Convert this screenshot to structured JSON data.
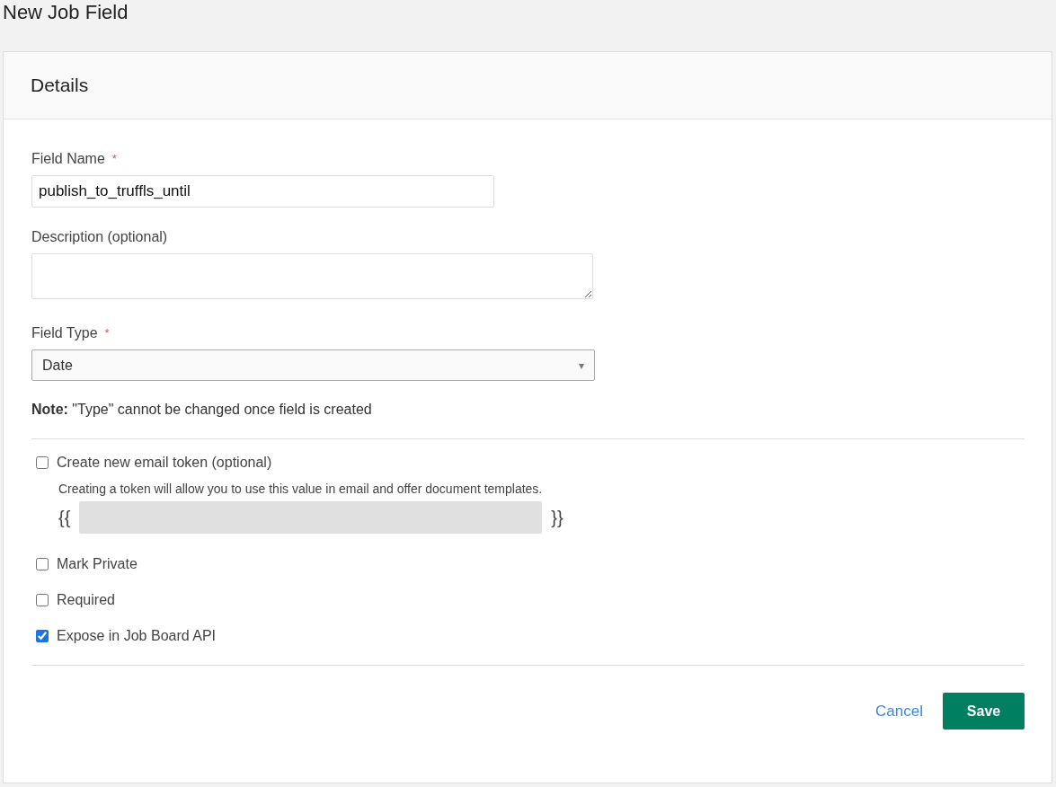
{
  "page_title": "New Job Field",
  "card": {
    "title": "Details"
  },
  "fields": [
    {
      "kind": "text",
      "label": "Field Name",
      "required_mark": "*",
      "value": "publish_to_truffls_until"
    },
    {
      "kind": "textarea",
      "label": "Description (optional)"
    },
    {
      "kind": "select",
      "label": "Field Type",
      "required_mark": "*",
      "value": "Date",
      "arrow": "▾"
    }
  ],
  "note": "**Note:** \"Type\" cannot be changed once field is created",
  "options": [
    {
      "kind": "token",
      "label": "Create new email token (optional)",
      "checked": false,
      "hint": "Creating a token will allow you to use this value in email and offer document templates.",
      "token_open": "{{",
      "token_close": "}}",
      "token_disabled": true
    },
    {
      "kind": "plain",
      "label": "Mark Private",
      "checked": false
    },
    {
      "kind": "plain",
      "label": "Required",
      "checked": false
    },
    {
      "kind": "plain",
      "label": "Expose in Job Board API",
      "checked": true
    }
  ],
  "actions": {
    "cancel": "Cancel",
    "save": "Save"
  }
}
